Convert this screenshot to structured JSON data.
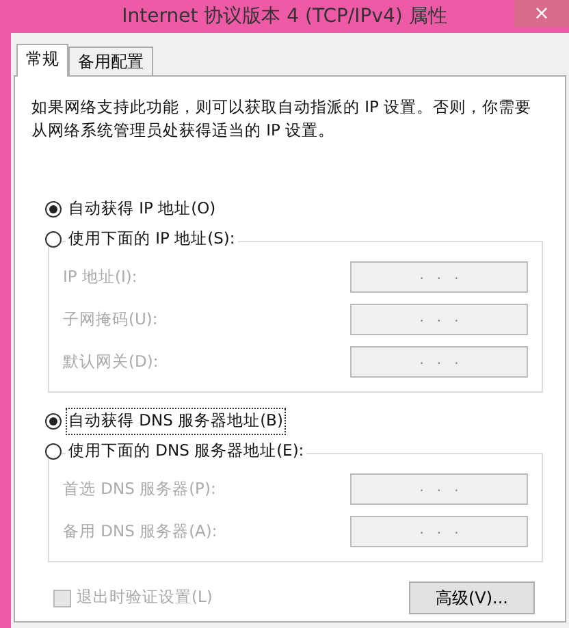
{
  "window": {
    "title": "Internet 协议版本 4 (TCP/IPv4) 属性",
    "close": "×"
  },
  "tabs": [
    {
      "label": "常规",
      "selected": true
    },
    {
      "label": "备用配置",
      "selected": false
    }
  ],
  "description": "如果网络支持此功能，则可以获取自动指派的 IP 设置。否则，你需要从网络系统管理员处获得适当的 IP 设置。",
  "ip_section": {
    "options": [
      {
        "label": "自动获得 IP 地址(O)",
        "selected": true,
        "focused": false
      },
      {
        "label": "使用下面的 IP 地址(S):",
        "selected": false,
        "focused": false
      }
    ],
    "fields": [
      {
        "label": "IP 地址(I):",
        "value": ".   .   .",
        "disabled": true
      },
      {
        "label": "子网掩码(U):",
        "value": ".   .   .",
        "disabled": true
      },
      {
        "label": "默认网关(D):",
        "value": ".   .   .",
        "disabled": true
      }
    ]
  },
  "dns_section": {
    "options": [
      {
        "label": "自动获得 DNS 服务器地址(B)",
        "selected": true,
        "focused": true
      },
      {
        "label": "使用下面的 DNS 服务器地址(E):",
        "selected": false,
        "focused": false
      }
    ],
    "fields": [
      {
        "label": "首选 DNS 服务器(P):",
        "value": ".   .   .",
        "disabled": true
      },
      {
        "label": "备用 DNS 服务器(A):",
        "value": ".   .   .",
        "disabled": true
      }
    ]
  },
  "validate_checkbox": {
    "label": "退出时验证设置(L)",
    "checked": false,
    "disabled": true
  },
  "advanced_button": "高级(V)..."
}
